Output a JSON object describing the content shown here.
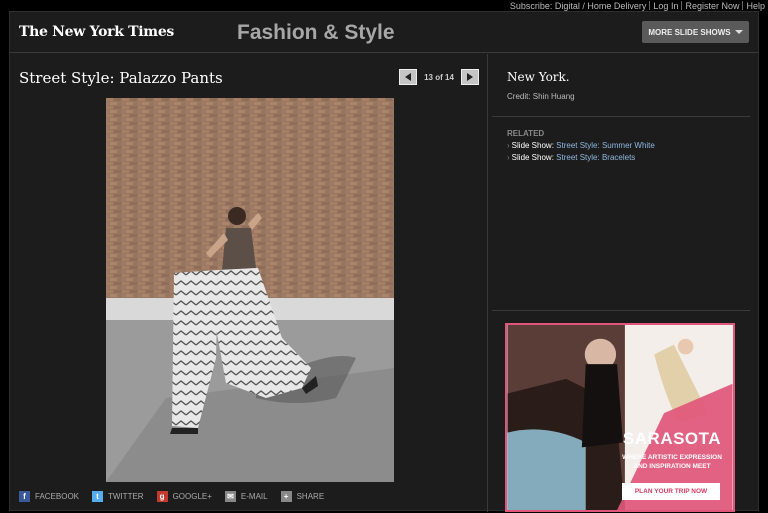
{
  "topbar": {
    "subscribe": "Subscribe: Digital / Home Delivery",
    "login": "Log In",
    "register": "Register Now",
    "help": "Help"
  },
  "header": {
    "logo": "The New York Times",
    "section": "Fashion & Style",
    "more_slideshows": "MORE SLIDE SHOWS"
  },
  "slideshow": {
    "title": "Street Style: Palazzo Pants",
    "counter": "13 of 14",
    "photo_alt": "Street style photograph: woman in wide palazzo pants posing in front of a brick wall"
  },
  "share": [
    {
      "label": "FACEBOOK",
      "icon": "facebook-icon",
      "color": "#3b5998",
      "glyph": "f"
    },
    {
      "label": "TWITTER",
      "icon": "twitter-icon",
      "color": "#55acee",
      "glyph": "t"
    },
    {
      "label": "GOOGLE+",
      "icon": "google-plus-icon",
      "color": "#c23b2c",
      "glyph": "g"
    },
    {
      "label": "E-MAIL",
      "icon": "email-icon",
      "color": "#888888",
      "glyph": "✉"
    },
    {
      "label": "SHARE",
      "icon": "share-icon",
      "color": "#888888",
      "glyph": "+"
    }
  ],
  "caption": {
    "title": "New York.",
    "credit": "Credit: Shin Huang"
  },
  "related": {
    "heading": "RELATED",
    "items": [
      {
        "prefix": "Slide Show:",
        "link": "Street Style: Summer White"
      },
      {
        "prefix": "Slide Show:",
        "link": "Street Style: Bracelets"
      }
    ]
  },
  "ad": {
    "title": "SARASOTA",
    "subtitle_line1": "WHERE ARTISTIC EXPRESSION",
    "subtitle_line2": "AND INSPIRATION MEET",
    "button": "PLAN YOUR TRIP NOW",
    "accent": "#e0567a"
  }
}
